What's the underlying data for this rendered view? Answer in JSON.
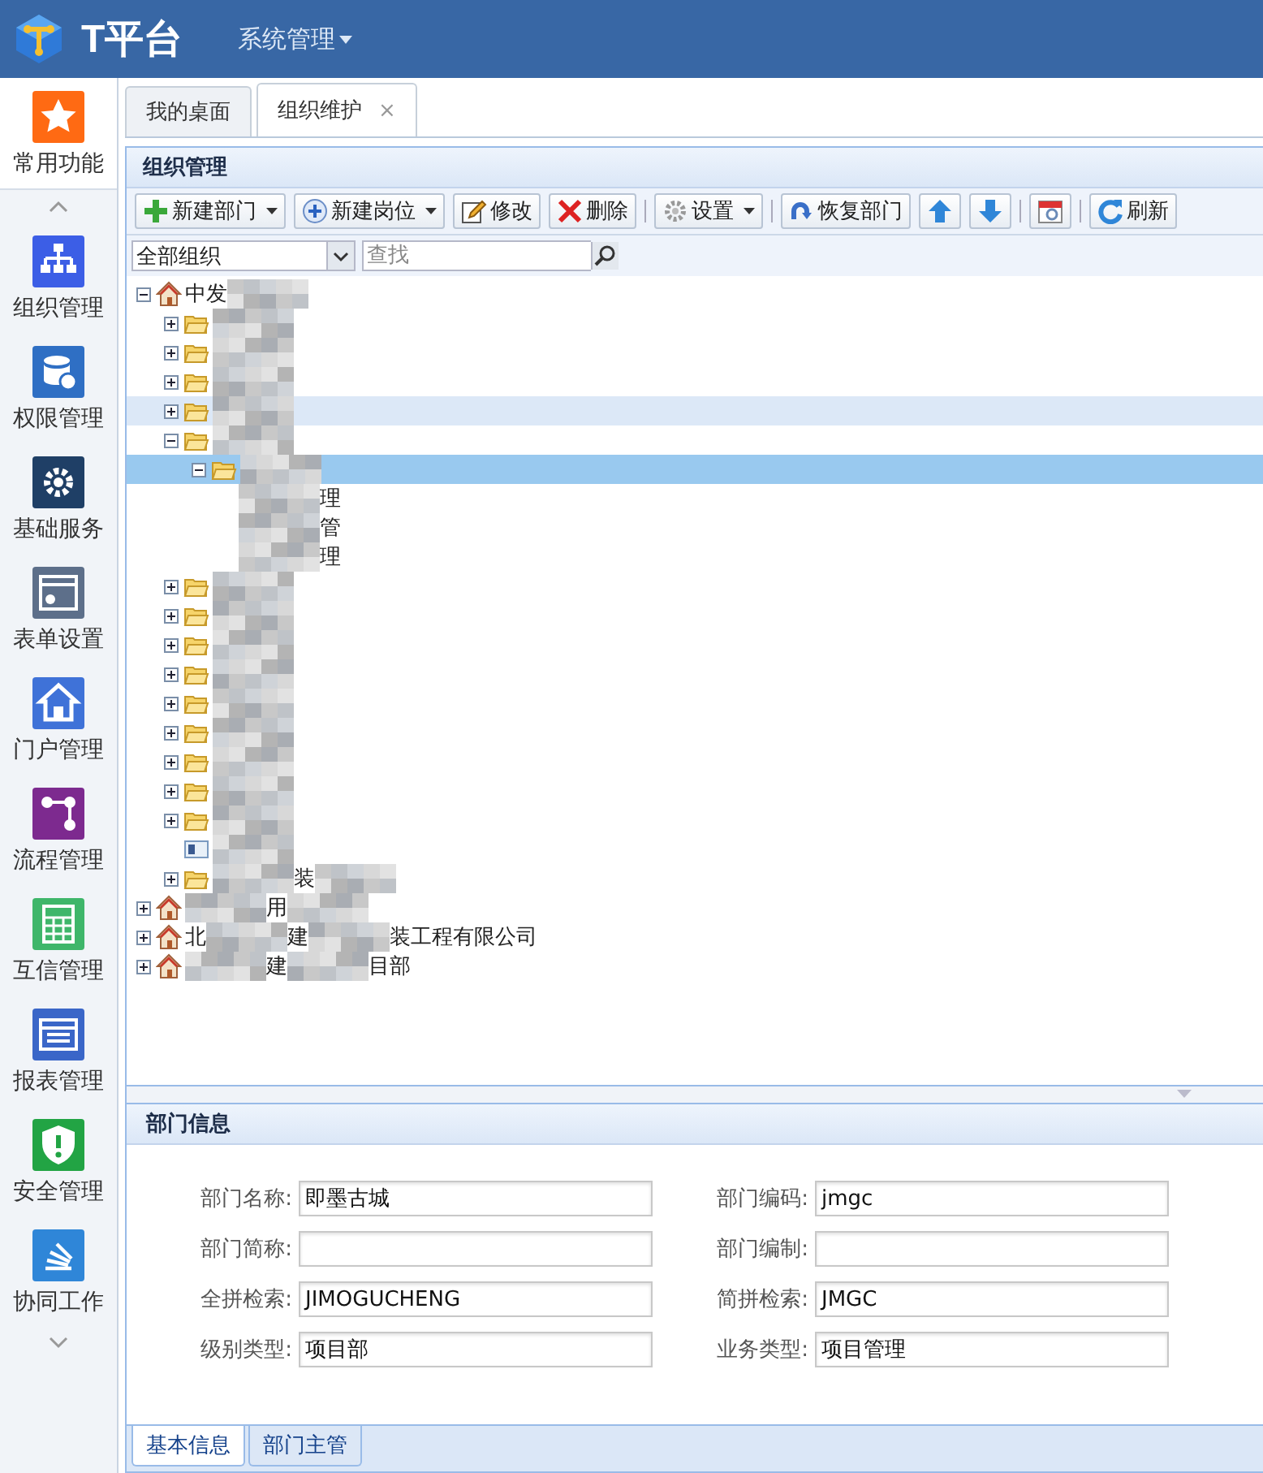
{
  "header": {
    "logo_text": "T平台",
    "menu": "系统管理"
  },
  "sidebar": {
    "items": [
      {
        "label": "常用功能",
        "kind": "star",
        "color": "#ff6a13",
        "selected": true
      },
      {
        "label": "组织管理",
        "kind": "org",
        "color": "#3c5ee6",
        "selected": false
      },
      {
        "label": "权限管理",
        "kind": "db",
        "color": "#2f6fc4",
        "selected": false
      },
      {
        "label": "基础服务",
        "kind": "gear",
        "color": "#1f3f66",
        "selected": false
      },
      {
        "label": "表单设置",
        "kind": "form",
        "color": "#5d6f8a",
        "selected": false
      },
      {
        "label": "门户管理",
        "kind": "home",
        "color": "#3f72d8",
        "selected": false
      },
      {
        "label": "流程管理",
        "kind": "flow",
        "color": "#7d2a8f",
        "selected": false
      },
      {
        "label": "互信管理",
        "kind": "grid",
        "color": "#3fb66a",
        "selected": false
      },
      {
        "label": "报表管理",
        "kind": "report",
        "color": "#3a66c8",
        "selected": false
      },
      {
        "label": "安全管理",
        "kind": "shield",
        "color": "#22a444",
        "selected": false
      },
      {
        "label": "协同工作",
        "kind": "stack",
        "color": "#2f86d8",
        "selected": false
      }
    ]
  },
  "tabs": [
    {
      "label": "我的桌面",
      "selected": false
    },
    {
      "label": "组织维护",
      "selected": true,
      "close": "×"
    }
  ],
  "panel_title": "组织管理",
  "toolbar": [
    {
      "kind": "plus",
      "label": "新建部门",
      "dropdown": true
    },
    {
      "kind": "plus-circle",
      "label": "新建岗位",
      "dropdown": true
    },
    {
      "kind": "edit",
      "label": "修改"
    },
    {
      "kind": "delete",
      "label": "删除"
    },
    {
      "kind": "separator"
    },
    {
      "kind": "gear",
      "label": "设置",
      "dropdown": true
    },
    {
      "kind": "separator"
    },
    {
      "kind": "redo",
      "label": "恢复部门"
    },
    {
      "kind": "up"
    },
    {
      "kind": "down"
    },
    {
      "kind": "separator"
    },
    {
      "kind": "calendar"
    },
    {
      "kind": "separator"
    },
    {
      "kind": "refresh",
      "label": "刷新"
    }
  ],
  "filter": {
    "scope": "全部组织",
    "search_placeholder": "查找"
  },
  "tree": [
    {
      "kind": "home",
      "expanded": true,
      "selected": false,
      "highlighted": false,
      "fragments": [
        {
          "kind": "text",
          "text": "中发"
        },
        {
          "kind": "mosaic"
        }
      ],
      "children": [
        {
          "kind": "folder",
          "expanded": false,
          "selected": false,
          "highlighted": false,
          "fragments": [
            {
              "kind": "mosaic"
            }
          ]
        },
        {
          "kind": "folder",
          "expanded": false,
          "selected": false,
          "highlighted": false,
          "fragments": [
            {
              "kind": "mosaic"
            }
          ]
        },
        {
          "kind": "folder",
          "expanded": false,
          "selected": false,
          "highlighted": false,
          "fragments": [
            {
              "kind": "mosaic"
            }
          ]
        },
        {
          "kind": "folder",
          "expanded": false,
          "selected": false,
          "highlighted": true,
          "fragments": [
            {
              "kind": "mosaic"
            }
          ]
        },
        {
          "kind": "folder",
          "expanded": true,
          "selected": false,
          "highlighted": false,
          "fragments": [
            {
              "kind": "mosaic"
            }
          ],
          "children": [
            {
              "kind": "folder",
              "expanded": true,
              "selected": true,
              "highlighted": false,
              "fragments": [
                {
                  "kind": "mosaic"
                }
              ],
              "children": [
                {
                  "selected": false,
                  "highlighted": false,
                  "fragments": [
                    {
                      "kind": "mosaic"
                    },
                    {
                      "kind": "text",
                      "text": "理"
                    }
                  ]
                },
                {
                  "selected": false,
                  "highlighted": false,
                  "fragments": [
                    {
                      "kind": "mosaic"
                    },
                    {
                      "kind": "text",
                      "text": "管"
                    }
                  ]
                },
                {
                  "selected": false,
                  "highlighted": false,
                  "fragments": [
                    {
                      "kind": "mosaic"
                    },
                    {
                      "kind": "text",
                      "text": "理"
                    }
                  ]
                }
              ]
            }
          ]
        },
        {
          "kind": "folder",
          "expanded": false,
          "selected": false,
          "highlighted": false,
          "fragments": [
            {
              "kind": "mosaic"
            }
          ]
        },
        {
          "kind": "folder",
          "expanded": false,
          "selected": false,
          "highlighted": false,
          "fragments": [
            {
              "kind": "mosaic"
            }
          ]
        },
        {
          "kind": "folder",
          "expanded": false,
          "selected": false,
          "highlighted": false,
          "fragments": [
            {
              "kind": "mosaic"
            }
          ]
        },
        {
          "kind": "folder",
          "expanded": false,
          "selected": false,
          "highlighted": false,
          "fragments": [
            {
              "kind": "mosaic"
            }
          ]
        },
        {
          "kind": "folder",
          "expanded": false,
          "selected": false,
          "highlighted": false,
          "fragments": [
            {
              "kind": "mosaic"
            }
          ]
        },
        {
          "kind": "folder",
          "expanded": false,
          "selected": false,
          "highlighted": false,
          "fragments": [
            {
              "kind": "mosaic"
            }
          ]
        },
        {
          "kind": "folder",
          "expanded": false,
          "selected": false,
          "highlighted": false,
          "fragments": [
            {
              "kind": "mosaic"
            }
          ]
        },
        {
          "kind": "folder",
          "expanded": false,
          "selected": false,
          "highlighted": false,
          "fragments": [
            {
              "kind": "mosaic"
            }
          ]
        },
        {
          "kind": "folder",
          "expanded": false,
          "selected": false,
          "highlighted": false,
          "fragments": [
            {
              "kind": "mosaic"
            }
          ]
        },
        {
          "kind": "user",
          "selected": false,
          "highlighted": false,
          "fragments": [
            {
              "kind": "mosaic"
            }
          ]
        },
        {
          "kind": "folder",
          "expanded": false,
          "selected": false,
          "highlighted": false,
          "fragments": [
            {
              "kind": "mosaic"
            },
            {
              "kind": "text",
              "text": "装"
            },
            {
              "kind": "mosaic"
            }
          ]
        }
      ]
    },
    {
      "kind": "home",
      "expanded": false,
      "selected": false,
      "highlighted": false,
      "fragments": [
        {
          "kind": "mosaic"
        },
        {
          "kind": "text",
          "text": "用"
        },
        {
          "kind": "mosaic"
        }
      ]
    },
    {
      "kind": "home",
      "expanded": false,
      "selected": false,
      "highlighted": false,
      "fragments": [
        {
          "kind": "text",
          "text": "北"
        },
        {
          "kind": "mosaic"
        },
        {
          "kind": "text",
          "text": "建"
        },
        {
          "kind": "mosaic"
        },
        {
          "kind": "text",
          "text": "装工程有限公司"
        }
      ]
    },
    {
      "kind": "home",
      "expanded": false,
      "selected": false,
      "highlighted": false,
      "fragments": [
        {
          "kind": "mosaic"
        },
        {
          "kind": "text",
          "text": "建"
        },
        {
          "kind": "mosaic"
        },
        {
          "kind": "text",
          "text": "目部"
        }
      ]
    }
  ],
  "detail": {
    "title": "部门信息",
    "fields": [
      {
        "label": "部门名称:",
        "value": "即墨古城"
      },
      {
        "label": "部门编码:",
        "value": "jmgc"
      },
      {
        "label": "部门简称:"
      },
      {
        "label": "部门编制:"
      },
      {
        "label": "全拼检索:",
        "value": "JIMOGUCHENG"
      },
      {
        "label": "简拼检索:",
        "value": "JMGC"
      },
      {
        "label": "级别类型:",
        "value": "项目部"
      },
      {
        "label": "业务类型:",
        "value": "项目管理"
      }
    ]
  },
  "bottom_tabs": [
    {
      "label": "基本信息",
      "selected": true
    },
    {
      "label": "部门主管",
      "selected": false
    }
  ]
}
